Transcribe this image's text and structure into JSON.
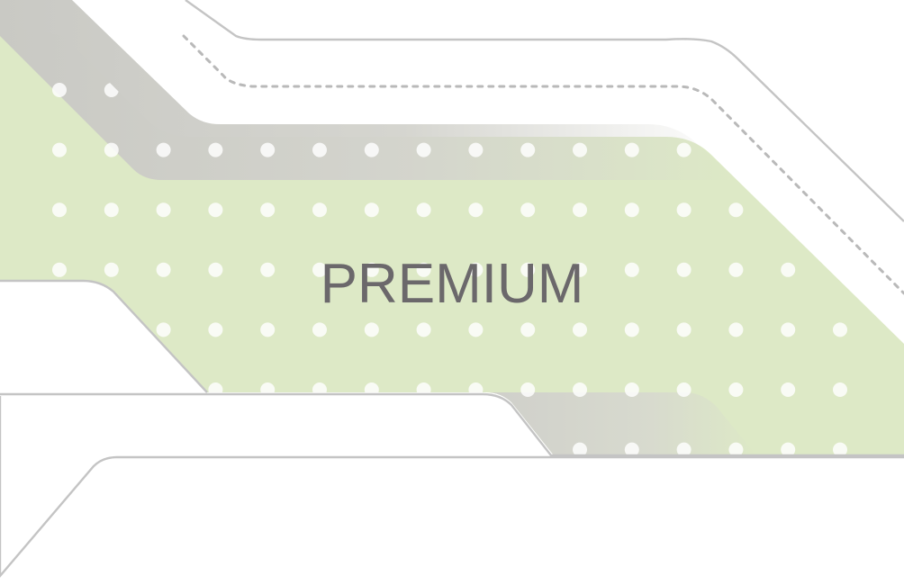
{
  "banner": {
    "title": "PREMIUM"
  },
  "colors": {
    "background": "#ffffff",
    "green_band": "#dde9c6",
    "grey_band": "#cbcbc6",
    "outline": "#c6c6c6",
    "dots": "#ffffff",
    "title_text": "#6b686b"
  }
}
